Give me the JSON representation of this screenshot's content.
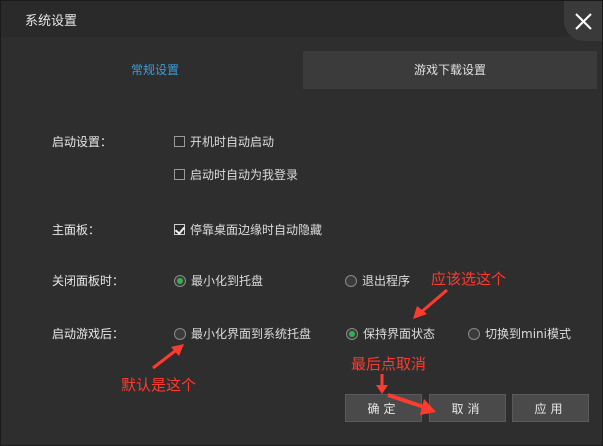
{
  "window": {
    "title": "系统设置"
  },
  "tabs": [
    {
      "label": "常规设置",
      "active": true
    },
    {
      "label": "游戏下载设置",
      "active": false
    }
  ],
  "startup": {
    "label": "启动设置：",
    "options": [
      {
        "label": "开机时自动启动",
        "checked": false
      },
      {
        "label": "启动时自动为我登录",
        "checked": false
      }
    ]
  },
  "panel": {
    "label": "主面板：",
    "option": {
      "label": "停靠桌面边缘时自动隐藏",
      "checked": true
    }
  },
  "close_panel": {
    "label": "关闭面板时：",
    "options": [
      {
        "label": "最小化到托盘",
        "selected": true
      },
      {
        "label": "退出程序",
        "selected": false
      }
    ]
  },
  "after_launch": {
    "label": "启动游戏后：",
    "options": [
      {
        "label": "最小化界面到系统托盘",
        "selected": false
      },
      {
        "label": "保持界面状态",
        "selected": true
      },
      {
        "label": "切换到mini模式",
        "selected": false
      }
    ]
  },
  "buttons": {
    "ok": "确定",
    "cancel": "取消",
    "apply": "应用"
  },
  "annotations": {
    "should_choose": "应该选这个",
    "default_is": "默认是这个",
    "finally_cancel": "最后点取消"
  },
  "colors": {
    "accent_tab": "#3b9ddd",
    "radio_selected": "#35b04a",
    "annotation": "#ff3b30"
  }
}
